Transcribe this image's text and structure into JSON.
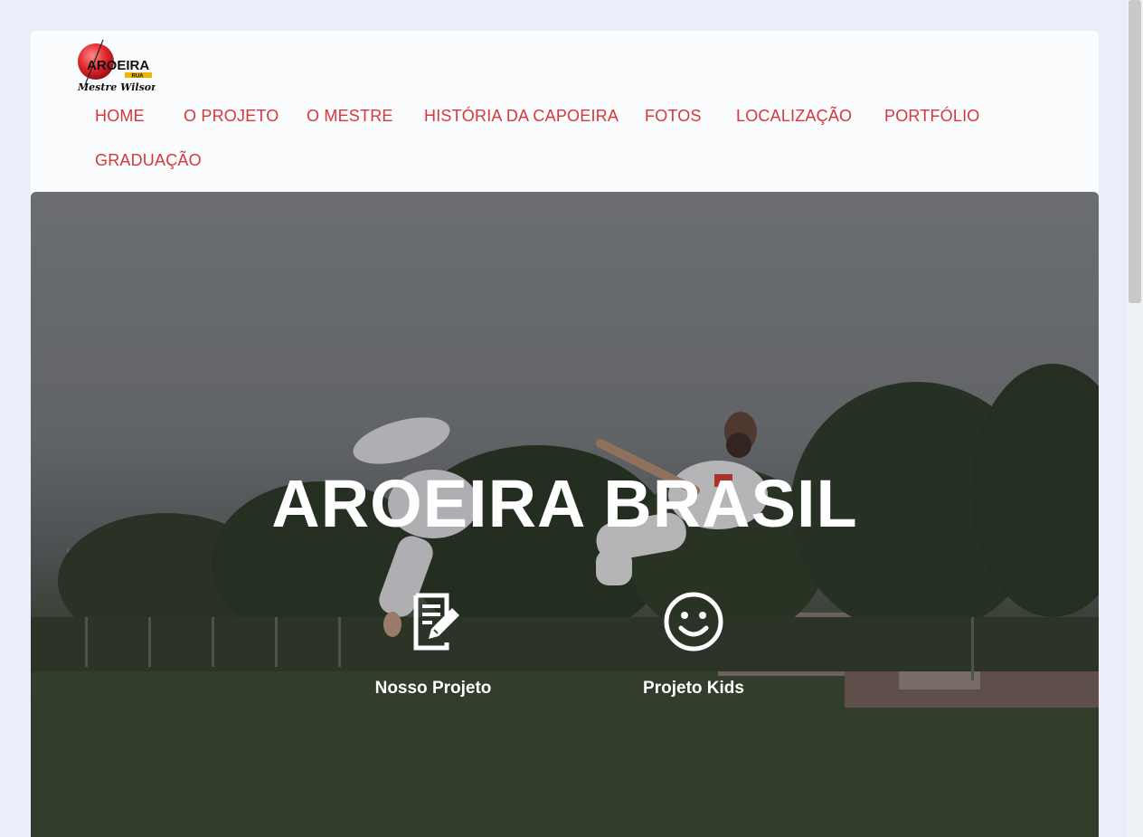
{
  "brand": {
    "logo_text": "AROEIRA",
    "logo_subtext": "Mestre Wilson",
    "logo_small": "RUA"
  },
  "nav": {
    "items": [
      {
        "label": "Home"
      },
      {
        "label": "O Projeto"
      },
      {
        "label": "O Mestre"
      },
      {
        "label": "História da Capoeira"
      },
      {
        "label": "Fotos"
      },
      {
        "label": "Localização"
      },
      {
        "label": "Portfólio"
      },
      {
        "label": "Graduação"
      }
    ]
  },
  "hero": {
    "title": "AROEIRA BRASIL",
    "features": [
      {
        "label": "Nosso Projeto",
        "icon": "document-edit-icon"
      },
      {
        "label": "Projeto Kids",
        "icon": "smiley-face-icon"
      }
    ]
  },
  "colors": {
    "nav_link": "#d8373a",
    "page_background": "#e9eef8",
    "card_background": "#fbfcfd",
    "hero_text": "#ffffff"
  }
}
